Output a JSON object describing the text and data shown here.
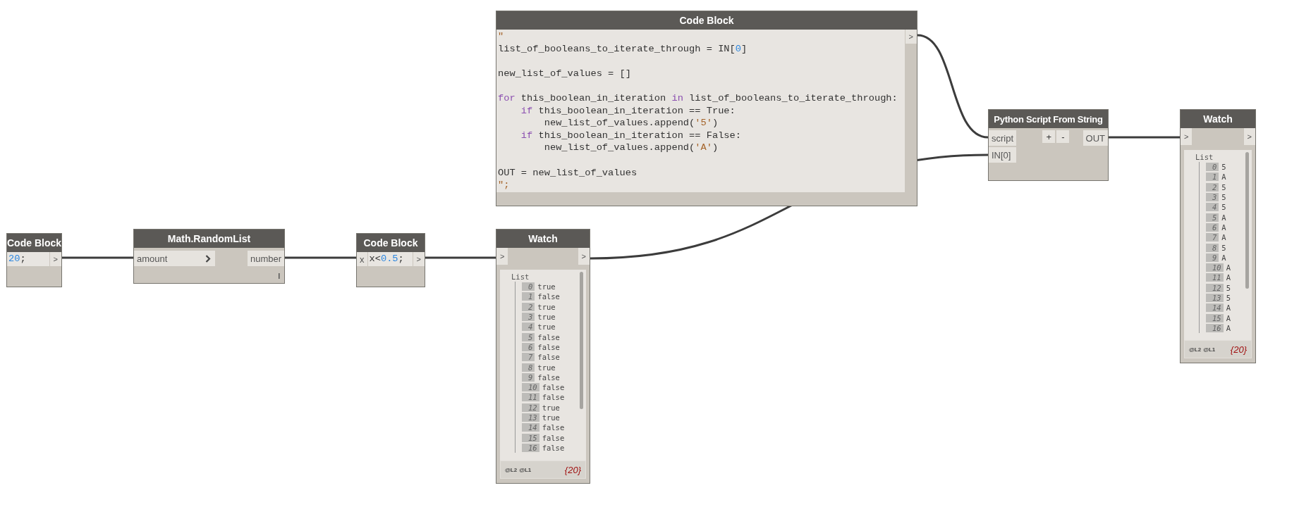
{
  "nodes": [
    {
      "kind": "code_block",
      "title": "Code Block",
      "code": [
        {
          "tokens": [
            {
              "text": "20",
              "kind": "number"
            },
            {
              "text": ";",
              "kind": "plain"
            }
          ]
        }
      ],
      "outputs": [
        {
          "label": ">"
        }
      ]
    },
    {
      "kind": "function",
      "title": "Math.RandomList",
      "inputs": [
        {
          "label": "amount",
          "chevron": true
        }
      ],
      "outputs": [
        {
          "label": "number"
        }
      ],
      "lacing": true
    },
    {
      "kind": "code_block",
      "title": "Code Block",
      "inputs": [
        {
          "label": "x"
        }
      ],
      "code": [
        {
          "tokens": [
            {
              "text": "x<",
              "kind": "plain"
            },
            {
              "text": "0.5",
              "kind": "number"
            },
            {
              "text": ";",
              "kind": "plain"
            }
          ]
        }
      ],
      "outputs": [
        {
          "label": ">"
        }
      ]
    },
    {
      "kind": "code_block",
      "title": "Code Block",
      "code": [
        {
          "tokens": [
            {
              "text": "\"",
              "kind": "string"
            }
          ]
        },
        {
          "tokens": [
            {
              "text": "list_of_booleans_to_iterate_through = IN[",
              "kind": "plain"
            },
            {
              "text": "0",
              "kind": "number"
            },
            {
              "text": "]",
              "kind": "plain"
            }
          ]
        },
        {
          "blank_before": true,
          "tokens": [
            {
              "text": "new_list_of_values = []",
              "kind": "plain"
            }
          ]
        },
        {
          "blank_before": true,
          "tokens": [
            {
              "text": "for",
              "kind": "keyword"
            },
            {
              "text": " this_boolean_in_iteration ",
              "kind": "plain"
            },
            {
              "text": "in",
              "kind": "keyword"
            },
            {
              "text": " list_of_booleans_to_iterate_through:",
              "kind": "plain"
            }
          ]
        },
        {
          "tokens": [
            {
              "text": "    if",
              "kind": "keyword"
            },
            {
              "text": " this_boolean_in_iteration == True:",
              "kind": "plain"
            }
          ]
        },
        {
          "tokens": [
            {
              "text": "        new_list_of_values.append(",
              "kind": "plain"
            },
            {
              "text": "'5'",
              "kind": "string"
            },
            {
              "text": ")",
              "kind": "plain"
            }
          ]
        },
        {
          "tokens": [
            {
              "text": "    if",
              "kind": "keyword"
            },
            {
              "text": " this_boolean_in_iteration == False:",
              "kind": "plain"
            }
          ]
        },
        {
          "tokens": [
            {
              "text": "        new_list_of_values.append(",
              "kind": "plain"
            },
            {
              "text": "'A'",
              "kind": "string"
            },
            {
              "text": ")",
              "kind": "plain"
            }
          ]
        },
        {
          "blank_before": true,
          "tokens": [
            {
              "text": "OUT = new_list_of_values",
              "kind": "plain"
            }
          ]
        },
        {
          "tokens": [
            {
              "text": "\";",
              "kind": "string"
            }
          ]
        }
      ],
      "outputs": [
        {
          "label": ">"
        }
      ]
    },
    {
      "kind": "watch",
      "title": "Watch",
      "inputs": [
        {
          "label": ">"
        }
      ],
      "outputs": [
        {
          "label": ">"
        }
      ],
      "list_label": "List",
      "items": [
        {
          "index": "0",
          "value": "true"
        },
        {
          "index": "1",
          "value": "false"
        },
        {
          "index": "2",
          "value": "true"
        },
        {
          "index": "3",
          "value": "true"
        },
        {
          "index": "4",
          "value": "true"
        },
        {
          "index": "5",
          "value": "false"
        },
        {
          "index": "6",
          "value": "false"
        },
        {
          "index": "7",
          "value": "false"
        },
        {
          "index": "8",
          "value": "true"
        },
        {
          "index": "9",
          "value": "false"
        },
        {
          "index": "10",
          "value": "false"
        },
        {
          "index": "11",
          "value": "false"
        },
        {
          "index": "12",
          "value": "true"
        },
        {
          "index": "13",
          "value": "true"
        },
        {
          "index": "14",
          "value": "false"
        },
        {
          "index": "15",
          "value": "false"
        },
        {
          "index": "16",
          "value": "false"
        }
      ],
      "levels": [
        "@L2",
        "@L1"
      ],
      "count": "{20}"
    },
    {
      "kind": "python",
      "title": "Python Script From String",
      "inputs": [
        {
          "label": "script"
        },
        {
          "label": "IN[0]"
        }
      ],
      "buttons": [
        {
          "label": "+"
        },
        {
          "label": "-"
        }
      ],
      "outputs": [
        {
          "label": "OUT"
        }
      ]
    },
    {
      "kind": "watch",
      "title": "Watch",
      "inputs": [
        {
          "label": ">"
        }
      ],
      "outputs": [
        {
          "label": ">"
        }
      ],
      "list_label": "List",
      "items": [
        {
          "index": "0",
          "value": "5"
        },
        {
          "index": "1",
          "value": "A"
        },
        {
          "index": "2",
          "value": "5"
        },
        {
          "index": "3",
          "value": "5"
        },
        {
          "index": "4",
          "value": "5"
        },
        {
          "index": "5",
          "value": "A"
        },
        {
          "index": "6",
          "value": "A"
        },
        {
          "index": "7",
          "value": "A"
        },
        {
          "index": "8",
          "value": "5"
        },
        {
          "index": "9",
          "value": "A"
        },
        {
          "index": "10",
          "value": "A"
        },
        {
          "index": "11",
          "value": "A"
        },
        {
          "index": "12",
          "value": "5"
        },
        {
          "index": "13",
          "value": "5"
        },
        {
          "index": "14",
          "value": "A"
        },
        {
          "index": "15",
          "value": "A"
        },
        {
          "index": "16",
          "value": "A"
        }
      ],
      "levels": [
        "@L2",
        "@L1"
      ],
      "count": "{20}"
    }
  ]
}
